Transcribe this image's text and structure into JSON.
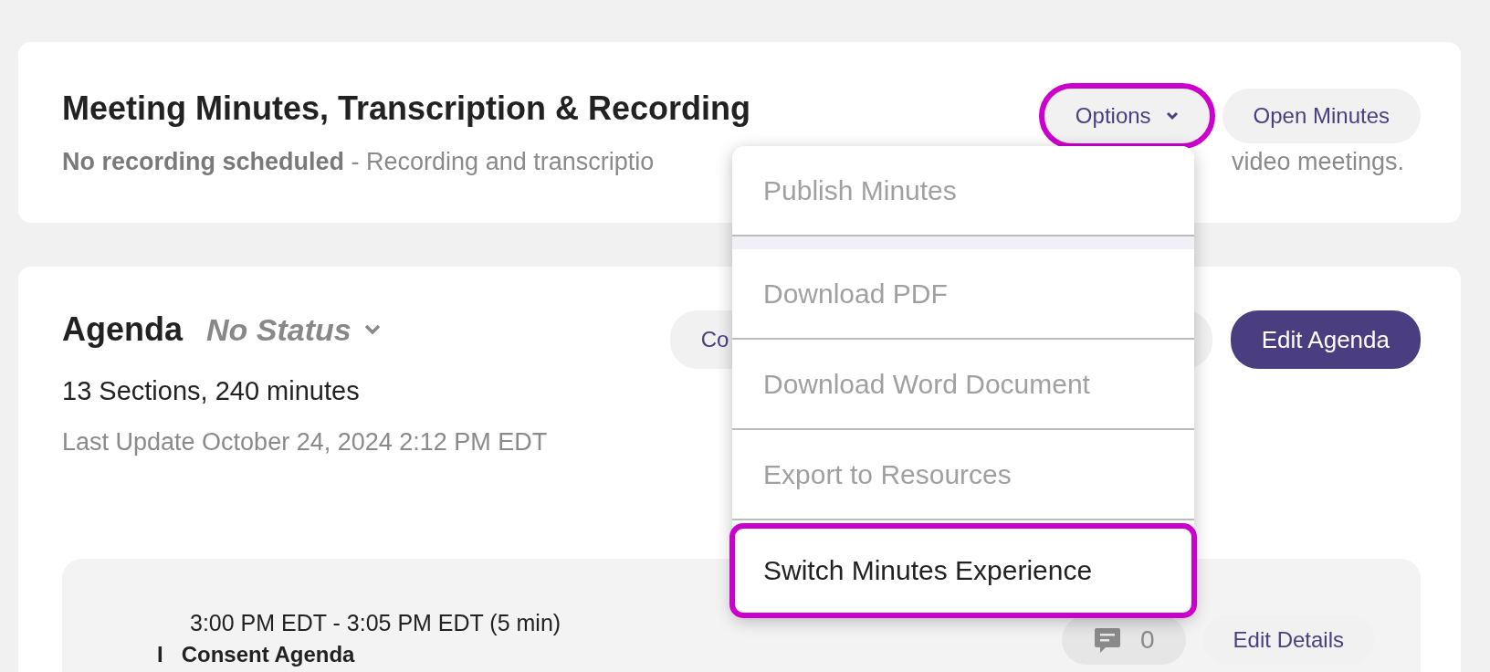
{
  "minutes_card": {
    "title": "Meeting Minutes, Transcription & Recording",
    "status_visible": "**No recording scheduled** - Recording and transcriptio",
    "status_tail": "video meetings.",
    "options_button": {
      "label": "Options",
      "highlighted": true,
      "expanded": true
    },
    "open_button": {
      "label": "Open Minutes"
    }
  },
  "options_menu": [
    {
      "label": "Publish Minutes",
      "disabled": true,
      "highlighted": false
    },
    {
      "kind": "spacer"
    },
    {
      "label": "Download PDF",
      "disabled": true,
      "highlighted": false
    },
    {
      "label": "Download Word Document",
      "disabled": true,
      "highlighted": false
    },
    {
      "label": "Export to Resources",
      "disabled": true,
      "highlighted": false
    },
    {
      "label": "Switch Minutes Experience",
      "disabled": false,
      "highlighted": true
    }
  ],
  "agenda_card": {
    "title": "Agenda",
    "status": "No Status",
    "summary": "13 Sections, 240 minutes",
    "last_update": "Last Update October 24, 2024 2:12 PM EDT",
    "hidden_button": "Co",
    "edit_button": "Edit Agenda",
    "items": [
      {
        "time": "3:00 PM EDT - 3:05 PM EDT (5 min)",
        "marker": "I",
        "title": "Consent Agenda",
        "comments": "0",
        "edit_label": "Edit Details"
      }
    ]
  }
}
